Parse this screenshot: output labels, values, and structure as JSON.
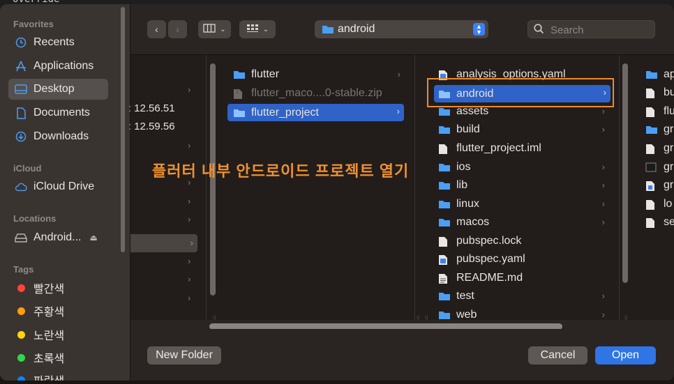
{
  "background_snippet": "override",
  "sidebar": {
    "favorites_header": "Favorites",
    "favorites": [
      {
        "label": "Recents",
        "icon": "clock-icon"
      },
      {
        "label": "Applications",
        "icon": "applications-icon"
      },
      {
        "label": "Desktop",
        "icon": "desktop-icon"
      },
      {
        "label": "Documents",
        "icon": "document-icon"
      },
      {
        "label": "Downloads",
        "icon": "download-icon"
      }
    ],
    "icloud_header": "iCloud",
    "icloud_drive": "iCloud Drive",
    "locations_header": "Locations",
    "location_item": "Android...",
    "tags_header": "Tags",
    "tags": [
      {
        "label": "빨간색",
        "color": "#ff453a"
      },
      {
        "label": "주황색",
        "color": "#ff9f0a"
      },
      {
        "label": "노란색",
        "color": "#ffd60a"
      },
      {
        "label": "초록색",
        "color": "#32d74b"
      },
      {
        "label": "파란색",
        "color": "#0a84ff"
      }
    ]
  },
  "toolbar": {
    "location_popup": "android",
    "search_placeholder": "Search"
  },
  "columns": {
    "col1_times": [
      "12.56.51",
      "12.59.56"
    ],
    "col2": [
      {
        "label": "flutter",
        "type": "folder",
        "has_children": true
      },
      {
        "label": "flutter_maco....0-stable.zip",
        "type": "zip",
        "dimmed": true
      },
      {
        "label": "flutter_project",
        "type": "folder",
        "has_children": true,
        "selected": true
      }
    ],
    "col3": [
      {
        "label": "analysis_options.yaml",
        "type": "yaml"
      },
      {
        "label": "android",
        "type": "folder",
        "has_children": true,
        "selected": true
      },
      {
        "label": "assets",
        "type": "folder",
        "has_children": true
      },
      {
        "label": "build",
        "type": "folder",
        "has_children": true
      },
      {
        "label": "flutter_project.iml",
        "type": "doc"
      },
      {
        "label": "ios",
        "type": "folder",
        "has_children": true
      },
      {
        "label": "lib",
        "type": "folder",
        "has_children": true
      },
      {
        "label": "linux",
        "type": "folder",
        "has_children": true
      },
      {
        "label": "macos",
        "type": "folder",
        "has_children": true
      },
      {
        "label": "pubspec.lock",
        "type": "doc"
      },
      {
        "label": "pubspec.yaml",
        "type": "yaml"
      },
      {
        "label": "README.md",
        "type": "md"
      },
      {
        "label": "test",
        "type": "folder",
        "has_children": true
      },
      {
        "label": "web",
        "type": "folder",
        "has_children": true
      }
    ],
    "col4": [
      {
        "label": "ap",
        "type": "folder"
      },
      {
        "label": "bu",
        "type": "doc"
      },
      {
        "label": "flu",
        "type": "doc"
      },
      {
        "label": "gr",
        "type": "folder"
      },
      {
        "label": "gr",
        "type": "doc"
      },
      {
        "label": "gr",
        "type": "exec"
      },
      {
        "label": "gr",
        "type": "win"
      },
      {
        "label": "lo",
        "type": "doc"
      },
      {
        "label": "se",
        "type": "doc"
      }
    ]
  },
  "annotation": "플러터 내부 안드로이드 프로젝트 열기",
  "footer": {
    "new_folder": "New Folder",
    "cancel": "Cancel",
    "open": "Open"
  },
  "colors": {
    "accent": "#2f75e5",
    "highlight_box": "#ef8b2c",
    "folder_blue": "#4a9ff5"
  }
}
